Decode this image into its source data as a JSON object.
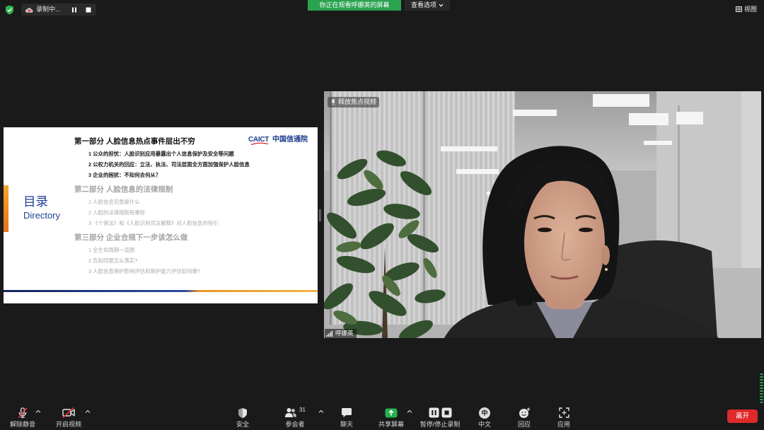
{
  "top_bar": {
    "recording_label": "录制中...",
    "viewing_banner": "你正在观看呼娜英的屏幕",
    "view_options_label": "查看选项",
    "view_label": "视图"
  },
  "shared_screen": {
    "title_cn": "目录",
    "title_en": "Directory",
    "logo": {
      "abbr": "CAICT",
      "name": "中国信通院"
    },
    "sections": [
      {
        "heading": "第一部分 人脸信息热点事件层出不穷",
        "active": true,
        "items": [
          "1 公众的担忧：人脸识别应用暴露出个人信息保护及安全等问题",
          "2 公权力机关的回应：立法、执法、司法层面全方面加强保护人脸信息",
          "3 企业的困扰：不知何去何从？"
        ]
      },
      {
        "heading": "第二部分 人脸信息的法律规制",
        "active": false,
        "items": [
          "1 人脸信息究竟是什么",
          "2 人脸的法律规制有哪些",
          "3 《个保法》和《人脸识别司法解释》对人脸信息的指引"
        ]
      },
      {
        "heading": "第三部分 企业合规下一步该怎么做",
        "active": false,
        "items": [
          "1 全生命周期一览图",
          "2 告知同意怎么落实?",
          "3 人脸信息保护影响评估和保护能力评估如何做?"
        ]
      }
    ]
  },
  "video": {
    "focus_label": "释放焦点视频",
    "participant_name": "呼娜英"
  },
  "toolbar": {
    "items": [
      {
        "id": "unmute",
        "label": "解除静音",
        "icon": "microphone-muted-icon"
      },
      {
        "id": "start_video",
        "label": "开启视频",
        "icon": "video-off-icon"
      },
      {
        "id": "security",
        "label": "安全",
        "icon": "shield-icon"
      },
      {
        "id": "participants",
        "label": "参会者",
        "icon": "participants-icon"
      },
      {
        "id": "chat",
        "label": "聊天",
        "icon": "chat-bubble-icon"
      },
      {
        "id": "share_screen",
        "label": "共享屏幕",
        "icon": "share-screen-icon"
      },
      {
        "id": "recording",
        "label": "暂停/停止录制",
        "icon": "pause-stop-record-icon"
      },
      {
        "id": "language",
        "label": "中文",
        "icon": "language-icon"
      },
      {
        "id": "reactions",
        "label": "回应",
        "icon": "reaction-emoji-icon"
      },
      {
        "id": "apps",
        "label": "应用",
        "icon": "apps-icon"
      }
    ],
    "participant_count": "31",
    "language_glyph": "中",
    "leave_label": "离开"
  },
  "colors": {
    "background": "#1a1a1a",
    "banner_green": "#2ba24f",
    "share_green": "#23b14d",
    "leave_red": "#e0292b",
    "mute_red": "#e5383b",
    "slide_blue": "#1d4295",
    "slide_orange": "#f0962a",
    "inactive_grey": "#a9a9a9"
  }
}
